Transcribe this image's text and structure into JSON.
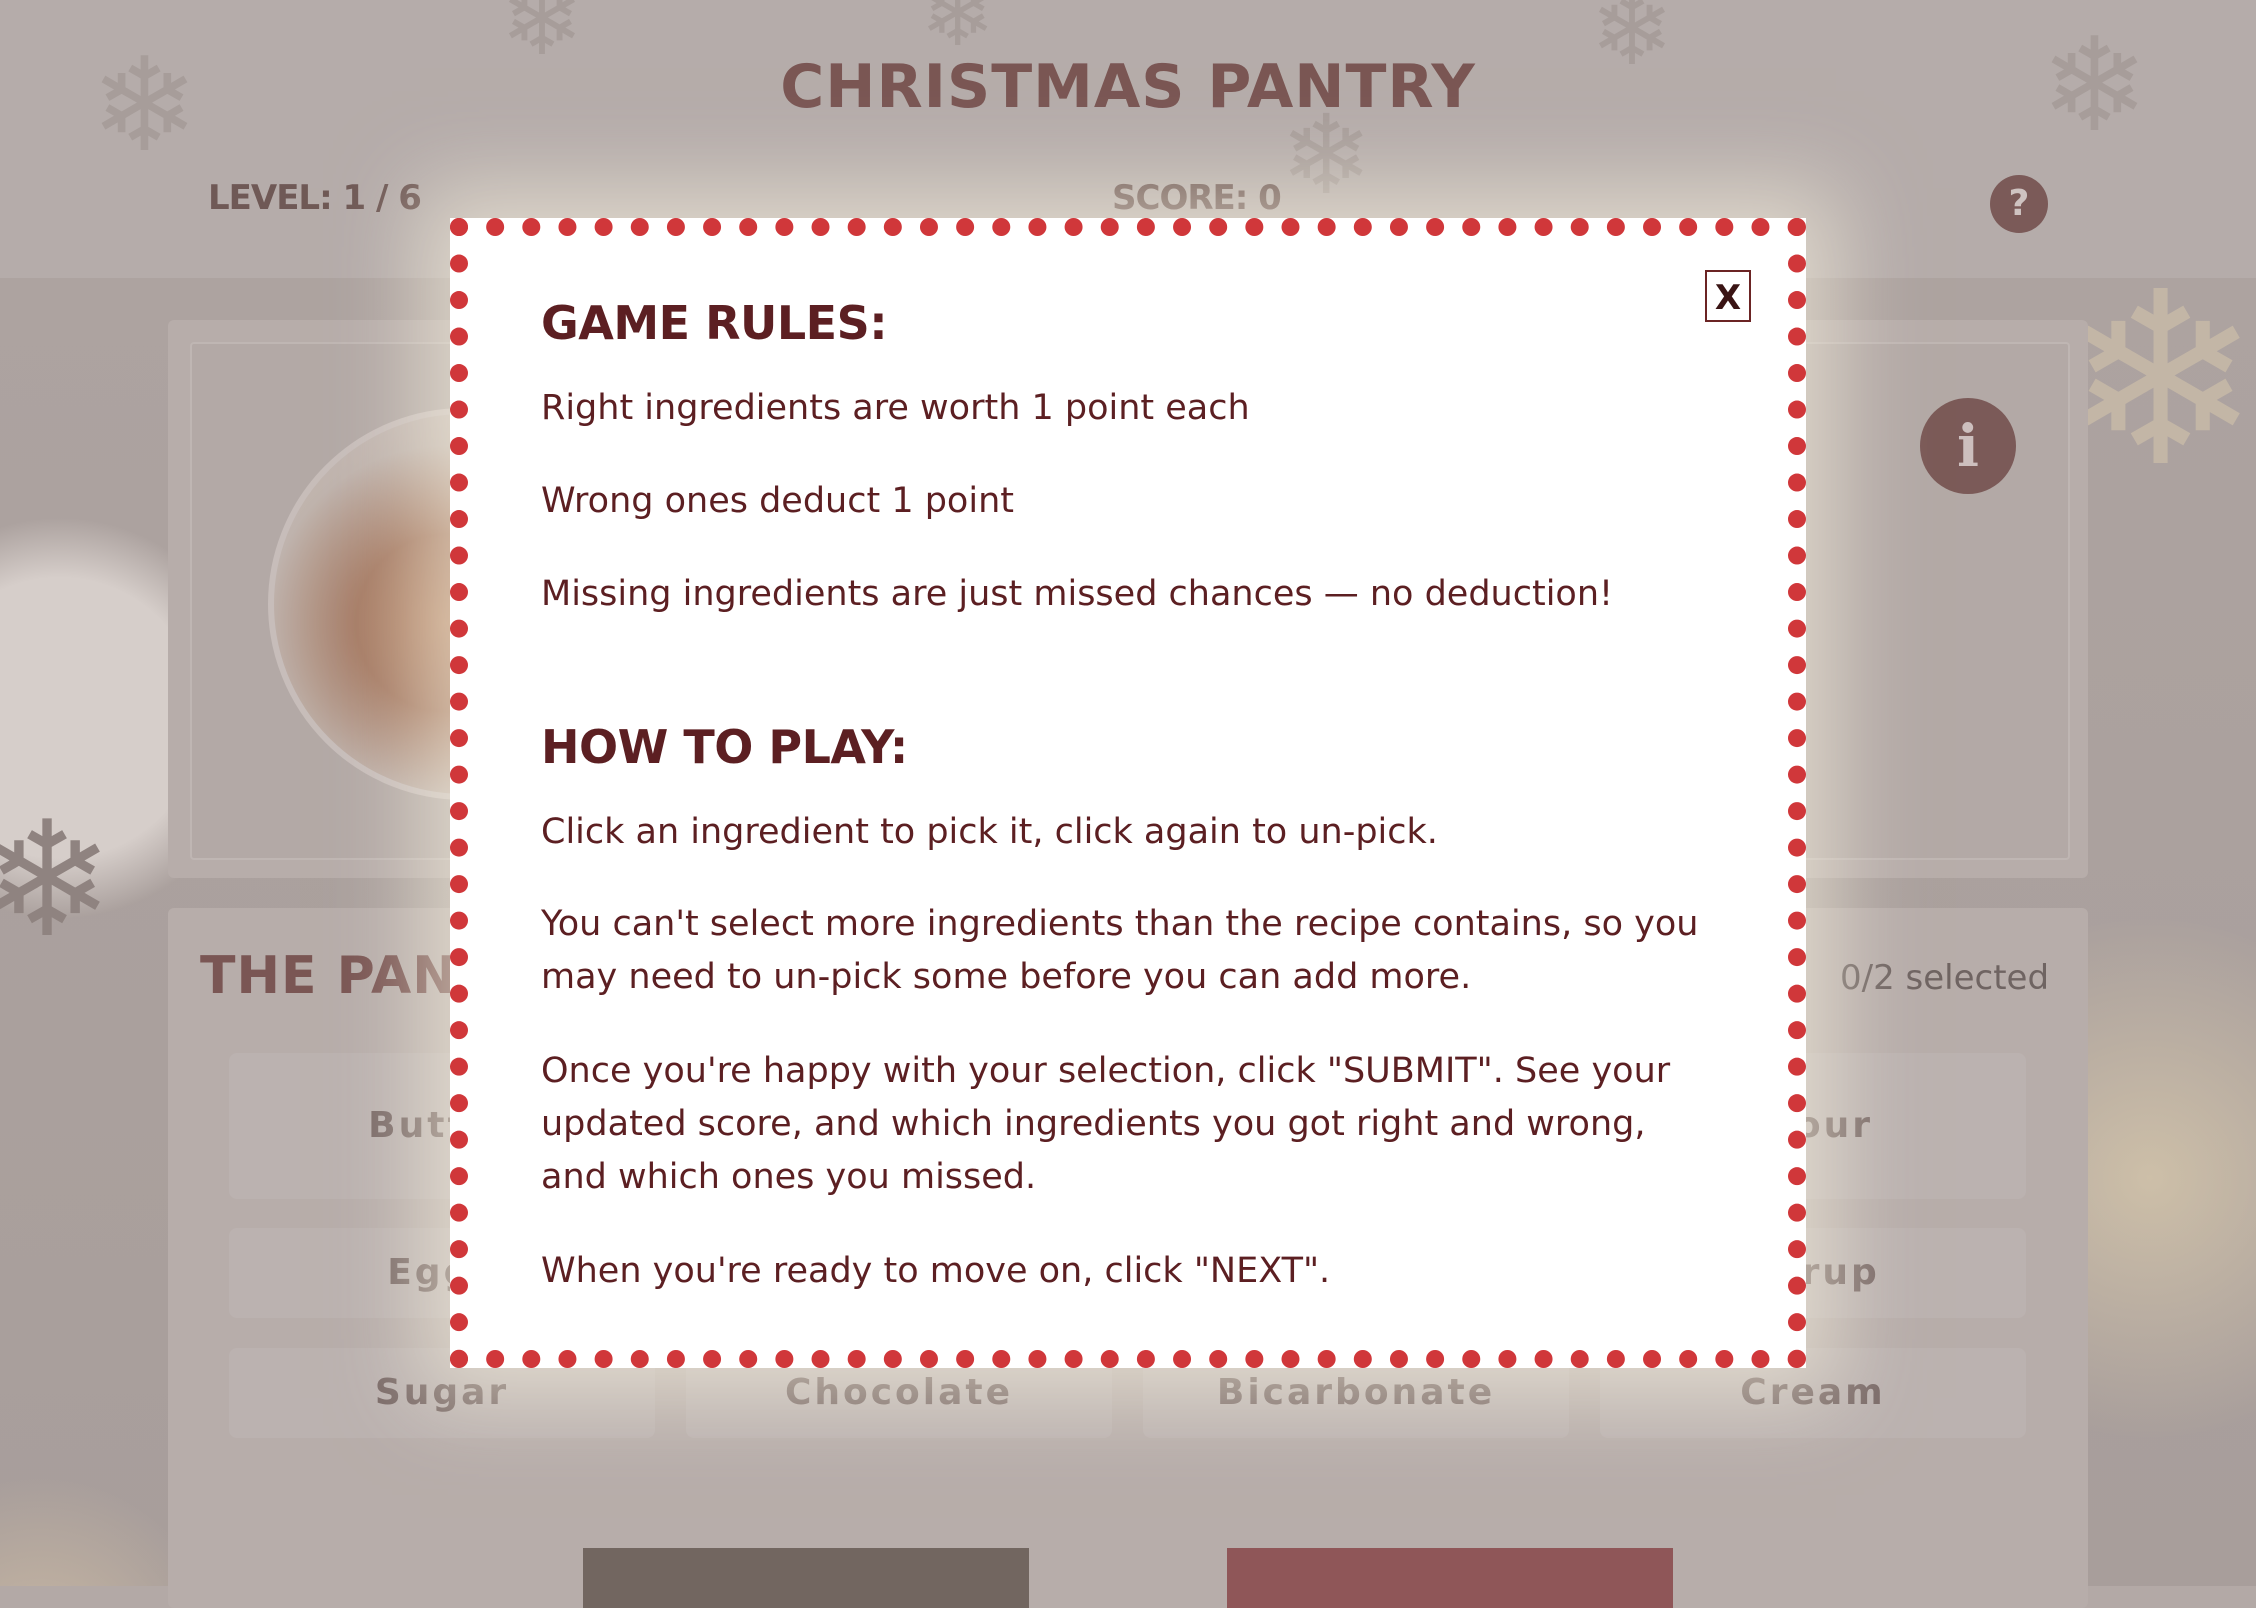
{
  "header": {
    "title": "CHRISTMAS PANTRY",
    "level_label": "LEVEL: 1 / 6",
    "score_label": "SCORE: 0",
    "help_icon": "?"
  },
  "recipe": {
    "info_icon": "i"
  },
  "pantry": {
    "title": "THE PANTRY",
    "selected_count": "0/2 selected",
    "ingredients": [
      "Butter",
      "Flour",
      "Eggs",
      "Syrup",
      "Sugar",
      "Chocolate",
      "Bicarbonate",
      "Cream"
    ]
  },
  "modal": {
    "close_label": "X",
    "rules_heading": "GAME RULES:",
    "rules": [
      "Right ingredients are worth 1 point each",
      "Wrong ones deduct 1 point",
      "Missing ingredients are just missed chances — no deduction!"
    ],
    "howto_heading": "HOW TO PLAY:",
    "howto": [
      "Click an ingredient to pick it, click again to un-pick.",
      "You can't select more ingredients than the recipe contains, so you may need to un-pick some before you can add more.",
      "Once you're happy with your selection, click \"SUBMIT\". See your updated score, and which ingredients you got right and wrong, and which ones you missed.",
      "When you're ready to move on, click \"NEXT\"."
    ]
  },
  "colors": {
    "accent_red": "#d0373a",
    "text_dark_red": "#5c1f22",
    "brand_brown": "#7b5a58"
  }
}
